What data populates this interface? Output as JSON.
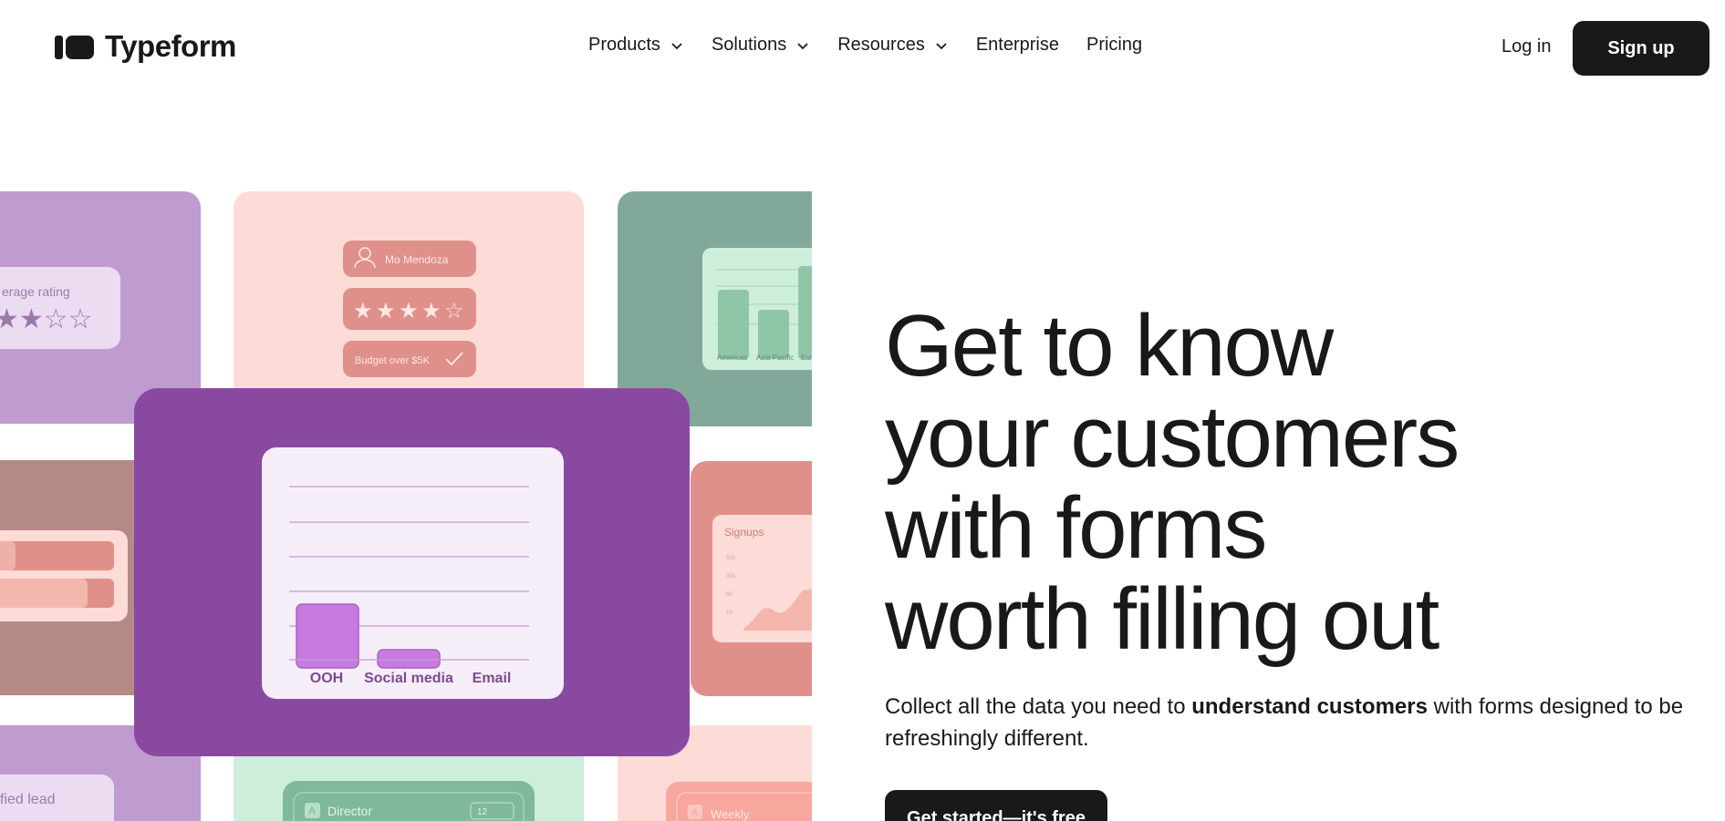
{
  "brand": {
    "name": "Typeform"
  },
  "nav": {
    "products": "Products",
    "solutions": "Solutions",
    "resources": "Resources",
    "enterprise": "Enterprise",
    "pricing": "Pricing"
  },
  "auth": {
    "login": "Log in",
    "signup": "Sign up"
  },
  "collage": {
    "rating_label": "erage rating",
    "rating_stars": "★★☆☆",
    "profile_name": "Mo Mendoza",
    "stars_filled": 4,
    "stars_total": 5,
    "budget_label": "Budget over $5K",
    "region_labels": [
      "Americas",
      "Asia Pacific",
      "Eur"
    ],
    "bar_categories": [
      "OOH",
      "Social media",
      "Email"
    ],
    "signups_label": "Signups",
    "signups_ticks": [
      "500",
      "300",
      "60",
      "10"
    ],
    "lead_label": "fied lead",
    "role_letter": "A",
    "role_label": "Director",
    "role_value": "12",
    "freq_letter": "A",
    "freq_label": "Weekly"
  },
  "hero": {
    "title_lines": [
      "Get to know",
      "your customers",
      "with forms",
      "worth filling out"
    ],
    "sub_pre": "Collect all the data you need to ",
    "sub_bold": "understand customers",
    "sub_post": " with forms designed to be refreshingly different.",
    "cta": "Get started—it's free"
  },
  "colors": {
    "dark": "#191919",
    "purple_main": "#8a49a1",
    "lilac": "#c09bcf",
    "blush": "#fddbd6",
    "sage": "#82a89a",
    "rose": "#df908a",
    "mauve": "#b58a86",
    "mint": "#cdeedb"
  }
}
